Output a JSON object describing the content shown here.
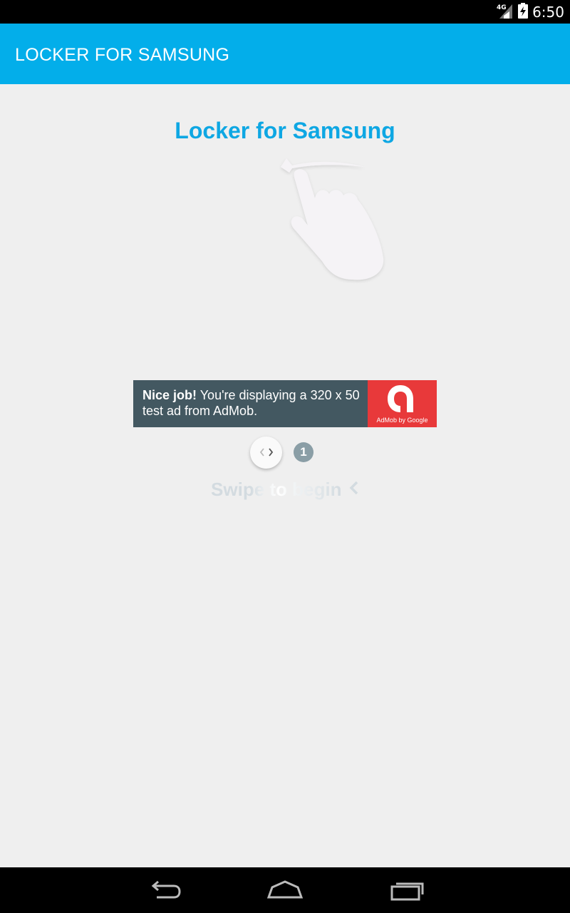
{
  "status_bar": {
    "network": "4G",
    "time": "6:50"
  },
  "app_bar": {
    "title": "LOCKER FOR SAMSUNG"
  },
  "content": {
    "headline": "Locker for Samsung",
    "illustration_icon": "swipe-hand-icon"
  },
  "ad": {
    "bold_text": "Nice job!",
    "text": "You're displaying a 320 x 50 test ad from AdMob.",
    "logo_label": "AdMob by Google",
    "colors": {
      "background": "#435861",
      "logo_background": "#e8393a"
    }
  },
  "pager": {
    "toggle_icon": "code-chevrons-icon",
    "count": "1"
  },
  "swipe_hint": {
    "label": "Swipe to begin",
    "icon": "chevron-left-icon"
  },
  "nav_bar": {
    "buttons": [
      "back-icon",
      "home-icon",
      "recents-icon"
    ]
  },
  "colors": {
    "accent": "#03aeea",
    "headline": "#0ea7e3",
    "background": "#efefef"
  }
}
